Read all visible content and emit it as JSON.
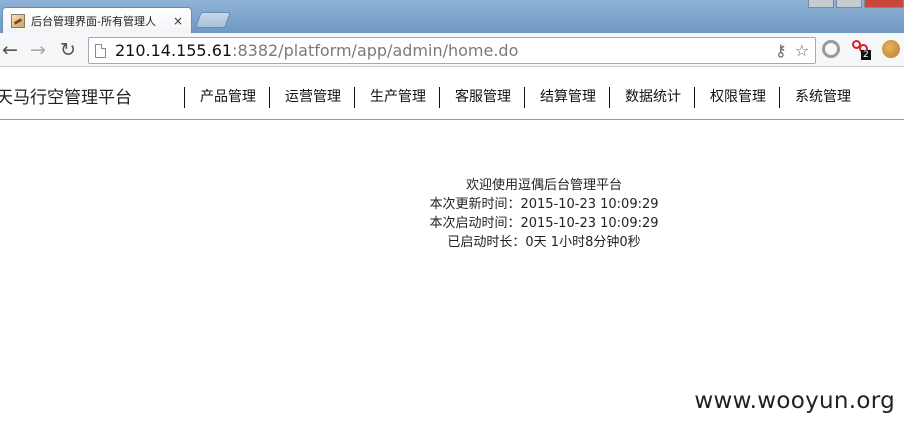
{
  "browser": {
    "tab_title": "后台管理界面-所有管理人",
    "tab_close": "×",
    "url_host": "210.14.155.61",
    "url_rest": ":8382/platform/app/admin/home.do",
    "ext_badge": "2"
  },
  "site": {
    "title": "天马行空管理平台",
    "menu": [
      "产品管理",
      "运营管理",
      "生产管理",
      "客服管理",
      "结算管理",
      "数据统计",
      "权限管理",
      "系统管理"
    ]
  },
  "welcome": {
    "line1": "欢迎使用逗偶后台管理平台",
    "line2": "本次更新时间：2015-10-23 10:09:29",
    "line3": "本次启动时间：2015-10-23 10:09:29",
    "line4": "已启动时长：0天 1小时8分钟0秒"
  },
  "watermark": "www.wooyun.org",
  "icons": {
    "back": "back-arrow-icon",
    "forward": "forward-arrow-icon",
    "reload": "reload-icon",
    "page": "page-icon",
    "key": "key-icon",
    "star": "star-icon"
  }
}
